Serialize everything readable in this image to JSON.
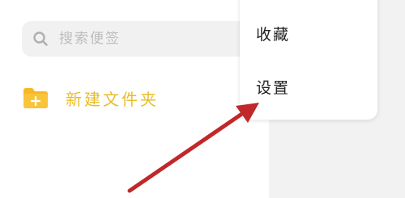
{
  "search": {
    "placeholder": "搜索便签",
    "icon": "search-icon"
  },
  "new_folder": {
    "label": "新建文件夹",
    "icon": "folder-plus-icon",
    "color": "#e9bd2a"
  },
  "menu": {
    "items": [
      {
        "label": "收藏"
      },
      {
        "label": "设置"
      }
    ]
  },
  "annotation": {
    "icon": "arrow-icon",
    "color": "#c0282a"
  }
}
